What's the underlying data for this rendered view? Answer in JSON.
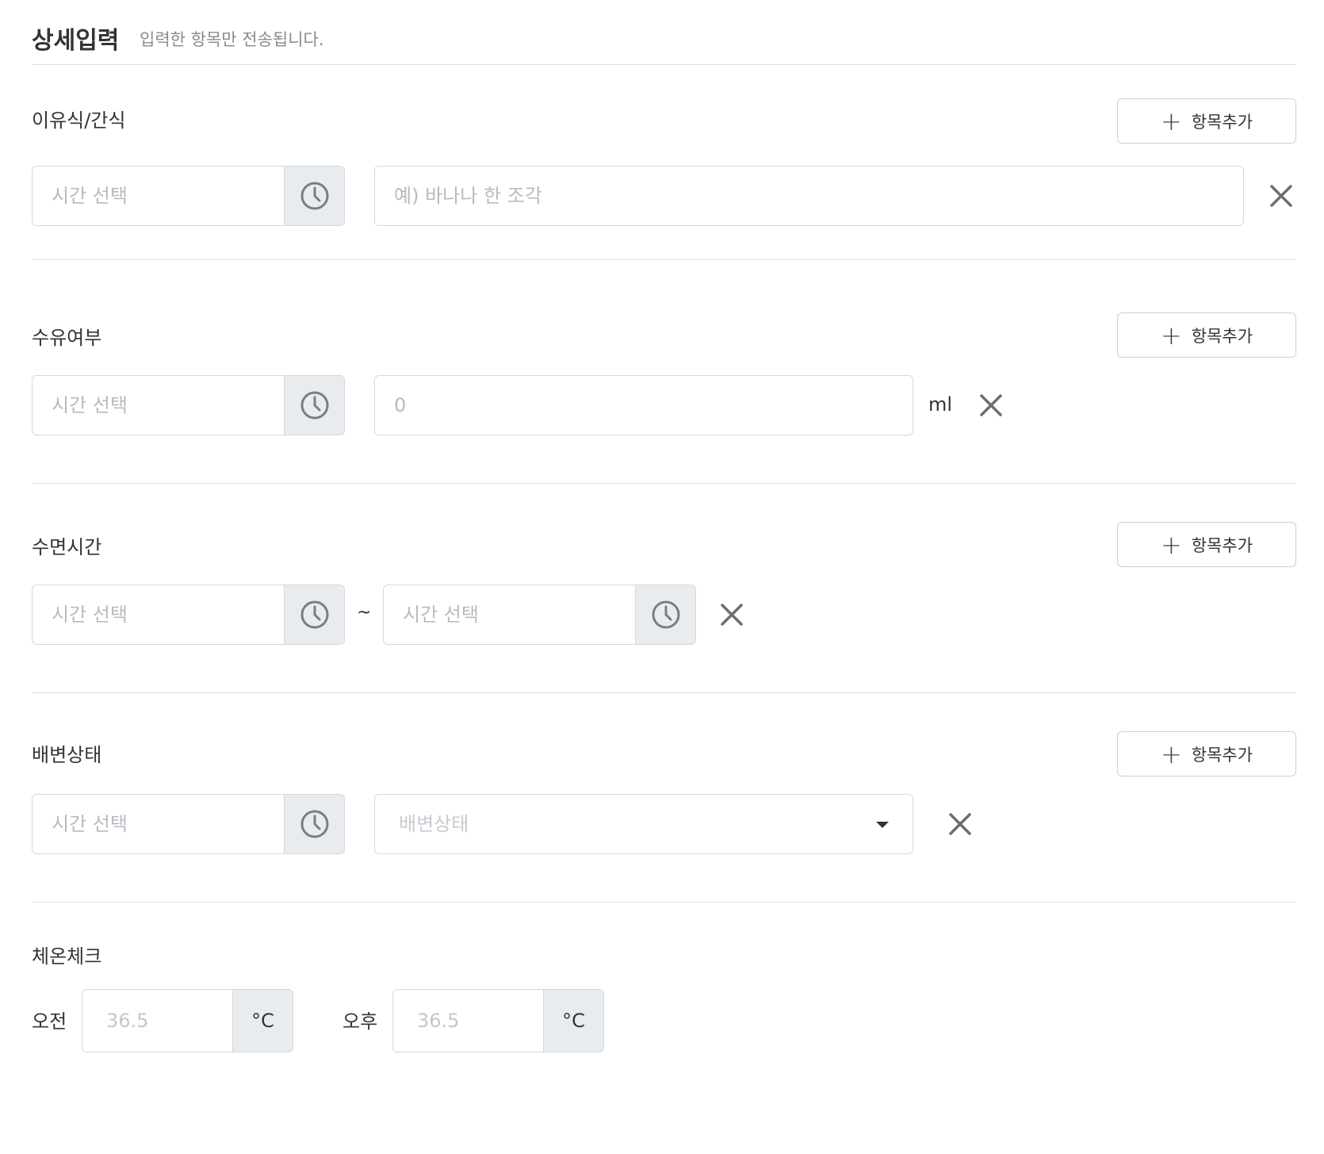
{
  "header": {
    "title": "상세입력",
    "subtitle": "입력한 항목만 전송됩니다."
  },
  "add_button_label": "항목추가",
  "time_placeholder": "시간 선택",
  "sections": {
    "meal": {
      "title": "이유식/간식",
      "food_placeholder": "예) 바나나 한 조각"
    },
    "feeding": {
      "title": "수유여부",
      "amount_placeholder": "0",
      "unit": "ml"
    },
    "sleep": {
      "title": "수면시간",
      "separator": "~"
    },
    "bowel": {
      "title": "배변상태",
      "select_placeholder": "배변상태"
    },
    "temperature": {
      "title": "체온체크",
      "am_label": "오전",
      "pm_label": "오후",
      "am_placeholder": "36.5",
      "pm_placeholder": "36.5",
      "unit": "°C"
    }
  },
  "colors": {
    "icon_gray": "#7a7e83",
    "border": "#d5d8dc",
    "addon_bg": "#e9ecef",
    "placeholder": "#b7bbc0"
  }
}
